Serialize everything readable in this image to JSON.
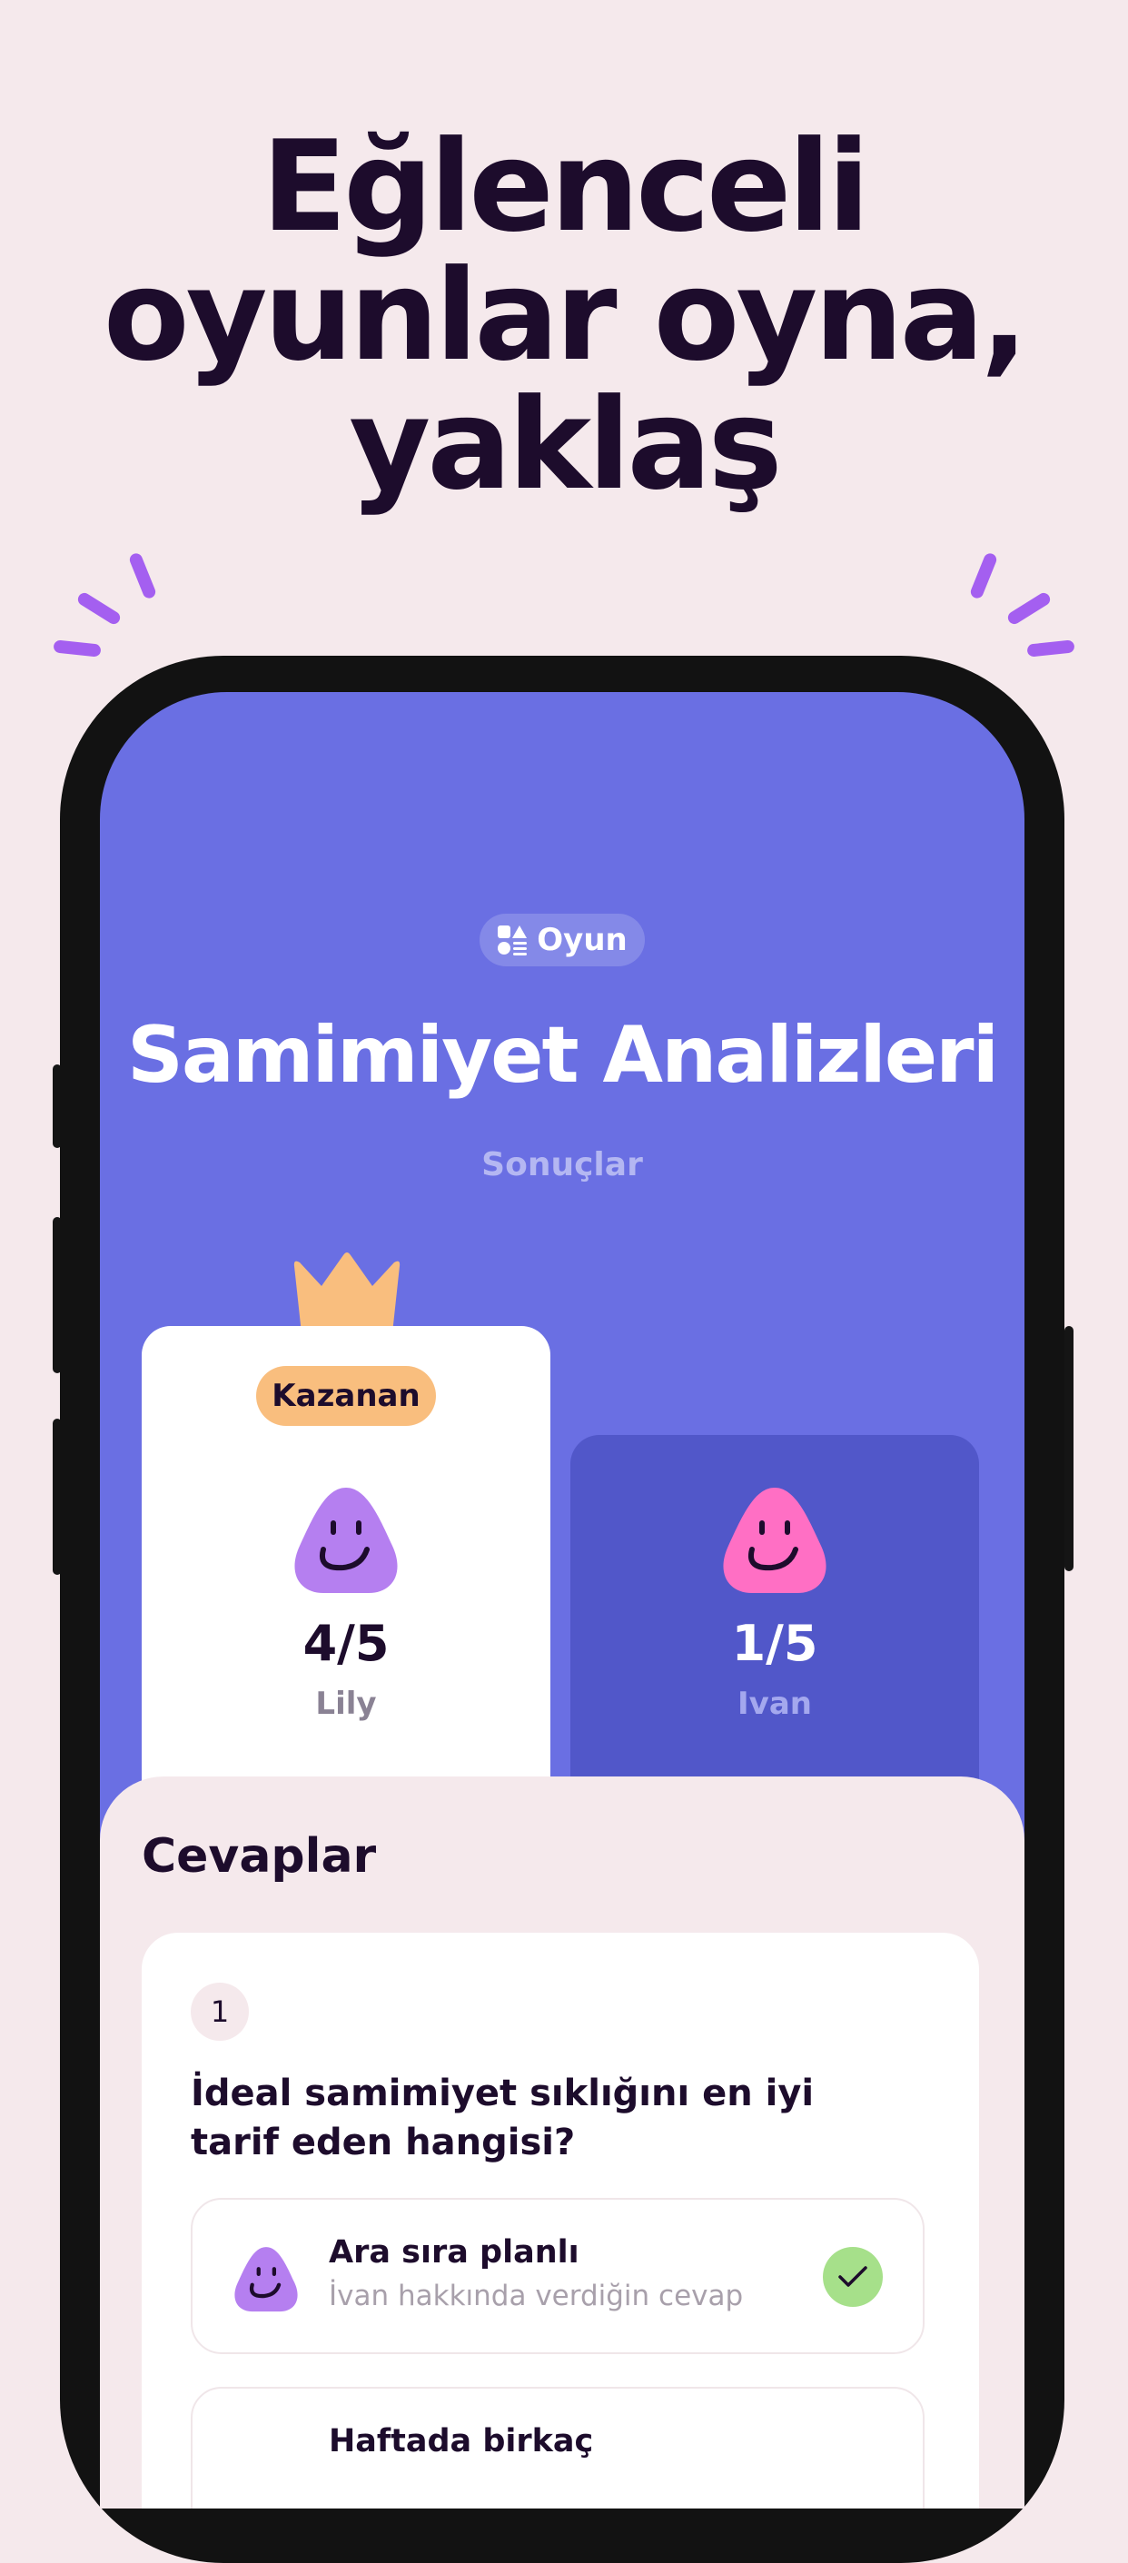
{
  "headline": {
    "line1": "Eğlenceli",
    "line2": "oyunlar oyna,",
    "line3": "yaklaş"
  },
  "colors": {
    "background": "#f5e9ec",
    "screen": "#6a6fe3",
    "loser_card": "#5157c9",
    "winner_badge": "#f9be7e",
    "crown": "#f9be7e",
    "accent_purple": "#b57ff0",
    "accent_pink": "#ff6fc4",
    "check": "#a6e08a",
    "text_dark": "#1d0c2c"
  },
  "game": {
    "tag_icon": "shapes-icon",
    "tag_label": "Oyun",
    "title": "Samimiyet Analizleri",
    "subtitle": "Sonuçlar"
  },
  "results": {
    "winner": {
      "badge": "Kazanan",
      "icon": "crown-icon",
      "avatar": "purple-blob-avatar",
      "score": "4/5",
      "name": "Lily"
    },
    "other": {
      "avatar": "pink-blob-avatar",
      "score": "1/5",
      "name": "Ivan"
    }
  },
  "answers": {
    "heading": "Cevaplar",
    "question": {
      "number": "1",
      "text": "İdeal samimiyet sıklığını en iyi tarif eden hangisi?",
      "options": [
        {
          "title": "Ara sıra planlı",
          "subtitle": "İvan hakkında verdiğin cevap",
          "icon": "check-icon"
        },
        {
          "title": "Haftada birkaç",
          "subtitle": ""
        }
      ]
    }
  }
}
